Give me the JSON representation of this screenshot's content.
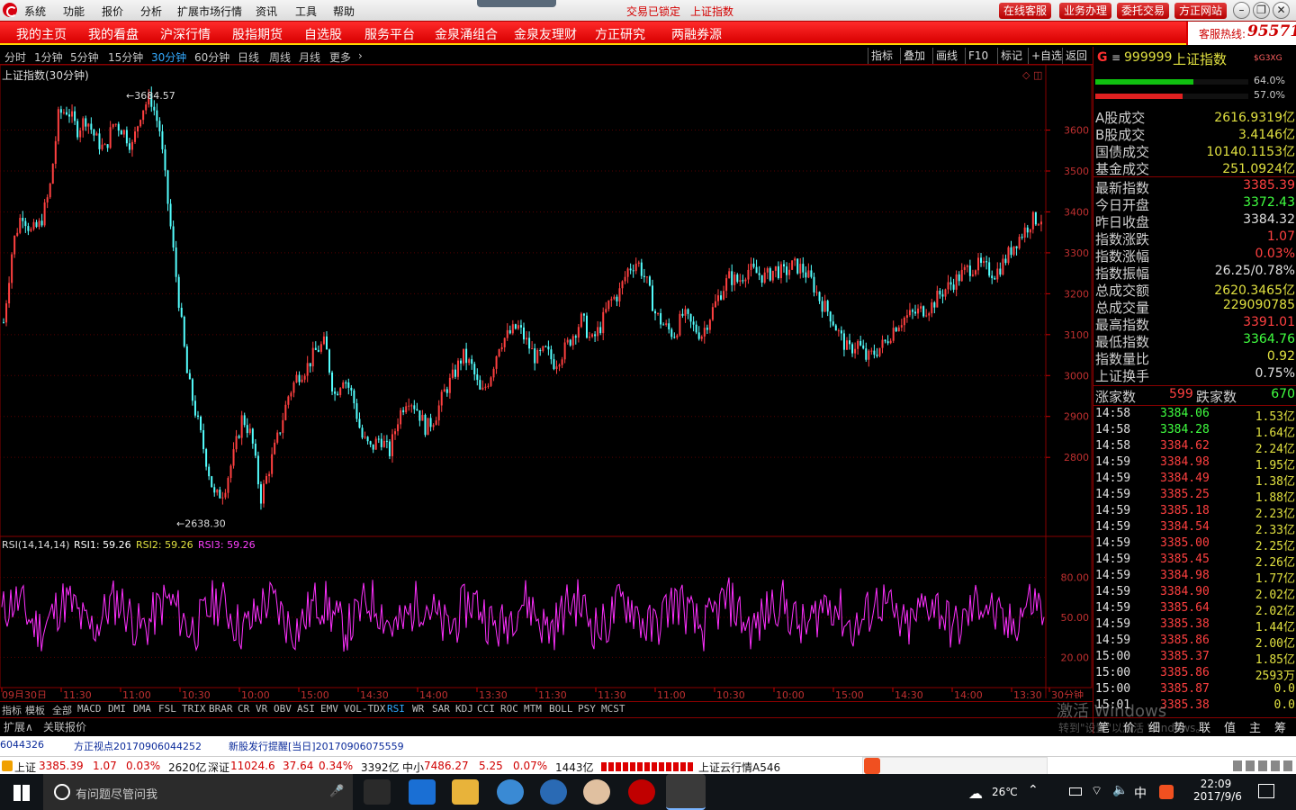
{
  "menubar": {
    "items": [
      "系统",
      "功能",
      "报价",
      "分析",
      "扩展市场行情",
      "资讯",
      "工具",
      "帮助"
    ],
    "status_lock": "交易已锁定",
    "status_index": "上证指数",
    "right_buttons": [
      "在线客服",
      "业务办理",
      "委托交易",
      "方正网站"
    ]
  },
  "navbar": {
    "items": [
      "我的主页",
      "我的看盘",
      "沪深行情",
      "股指期货",
      "自选股",
      "服务平台",
      "金泉涌组合",
      "金泉友理财",
      "方正研究",
      "两融券源"
    ],
    "hotline_label": "客服热线:",
    "hotline_number": "95571"
  },
  "periods": {
    "items": [
      "分时",
      "1分钟",
      "5分钟",
      "15分钟",
      "30分钟",
      "60分钟",
      "日线",
      "周线",
      "月线",
      "更多"
    ],
    "active": "30分钟",
    "tools": [
      "指标",
      "叠加",
      "画线",
      "F10",
      "标记",
      "+自选",
      "返回"
    ]
  },
  "chart_title": "上证指数(30分钟)",
  "chart_data": [
    {
      "type": "candlestick",
      "title": "上证指数(30分钟)",
      "y_ticks": [
        3600,
        3500,
        3400,
        3300,
        3200,
        3100,
        3000,
        2900,
        2800
      ],
      "ylim": [
        2620,
        3720
      ],
      "annotations": {
        "high": "3684.57",
        "low": "2638.30"
      },
      "x_tick_labels": [
        "09月30日",
        "11:30",
        "11:00",
        "10:30",
        "10:00",
        "15:00",
        "14:30",
        "14:00",
        "13:30",
        "11:30",
        "11:30",
        "11:00",
        "10:30",
        "10:00",
        "15:00",
        "14:30",
        "14:00",
        "13:30",
        "30分钟"
      ],
      "close_path": [
        3130,
        3320,
        3400,
        3350,
        3370,
        3450,
        3640,
        3650,
        3600,
        3630,
        3580,
        3550,
        3620,
        3600,
        3560,
        3650,
        3680,
        3600,
        3400,
        3200,
        3000,
        2900,
        2800,
        2700,
        2720,
        2800,
        2900,
        2850,
        2700,
        2780,
        2860,
        2950,
        3000,
        3020,
        3060,
        3080,
        2950,
        3000,
        2950,
        2850,
        2820,
        2850,
        2810,
        2900,
        2950,
        2920,
        2870,
        2900,
        2960,
        3000,
        3050,
        3020,
        2950,
        3000,
        3080,
        3100,
        3120,
        3080,
        3040,
        3060,
        3030,
        3060,
        3100,
        3140,
        3080,
        3120,
        3180,
        3200,
        3260,
        3280,
        3230,
        3150,
        3120,
        3100,
        3150,
        3120,
        3100,
        3150,
        3200,
        3240,
        3230,
        3260,
        3250,
        3240,
        3260,
        3250,
        3270,
        3260,
        3230,
        3180,
        3150,
        3100,
        3060,
        3080,
        3040,
        3060,
        3080,
        3120,
        3140,
        3150,
        3160,
        3170,
        3200,
        3220,
        3240,
        3260,
        3270,
        3260,
        3250,
        3280,
        3320,
        3350,
        3380,
        3385
      ]
    },
    {
      "type": "line",
      "title": "RSI(14,14,14)",
      "series": [
        {
          "name": "RSI1",
          "last": "59.26"
        },
        {
          "name": "RSI2",
          "last": "59.26"
        },
        {
          "name": "RSI3",
          "last": "59.26"
        }
      ],
      "y_ticks": [
        80,
        50,
        20
      ],
      "ylim": [
        0,
        100
      ]
    }
  ],
  "rsi_label": {
    "name": "RSI(14,14,14)",
    "rsi1": "RSI1: 59.26",
    "rsi2": "RSI2: 59.26",
    "rsi3": "RSI3: 59.26"
  },
  "indicators": {
    "items": [
      "指标",
      "模板",
      "全部",
      "MACD",
      "DMI",
      "DMA",
      "FSL",
      "TRIX",
      "BRAR",
      "CR",
      "VR",
      "OBV",
      "ASI",
      "EMV",
      "VOL-TDX",
      "RSI",
      "WR",
      "SAR",
      "KDJ",
      "CCI",
      "ROC",
      "MTM",
      "BOLL",
      "PSY",
      "MCST"
    ],
    "active": "RSI",
    "ext": [
      "扩展∧",
      "关联报价"
    ]
  },
  "stock": {
    "code": "999999",
    "name": "上证指数",
    "tag": "$G3XG",
    "bar1_pct": "64.0%",
    "bar2_pct": "57.0%",
    "bar1": 0.64,
    "bar2": 0.57,
    "turnover": [
      {
        "label": "A股成交",
        "value": "2616.9319亿"
      },
      {
        "label": "B股成交",
        "value": "3.4146亿"
      },
      {
        "label": "国债成交",
        "value": "10140.1153亿"
      },
      {
        "label": "基金成交",
        "value": "251.0924亿"
      }
    ],
    "stats": [
      {
        "label": "最新指数",
        "value": "3385.39",
        "color": "#ff4040"
      },
      {
        "label": "今日开盘",
        "value": "3372.43",
        "color": "#40ff40"
      },
      {
        "label": "昨日收盘",
        "value": "3384.32",
        "color": "#e0e0e0"
      },
      {
        "label": "指数涨跌",
        "value": "1.07",
        "color": "#ff4040"
      },
      {
        "label": "指数涨幅",
        "value": "0.03%",
        "color": "#ff4040"
      },
      {
        "label": "指数振幅",
        "value": "26.25/0.78%",
        "color": "#e0e0e0"
      },
      {
        "label": "总成交额",
        "value": "2620.3465亿",
        "color": "#e0e040"
      },
      {
        "label": "总成交量",
        "value": "229090785",
        "color": "#e0e040"
      },
      {
        "label": "最高指数",
        "value": "3391.01",
        "color": "#ff4040"
      },
      {
        "label": "最低指数",
        "value": "3364.76",
        "color": "#40ff40"
      },
      {
        "label": "指数量比",
        "value": "0.92",
        "color": "#e0e040"
      },
      {
        "label": "上证换手",
        "value": "0.75%",
        "color": "#e0e0e0"
      }
    ],
    "up_label": "涨家数",
    "up_count": "599",
    "down_label": "跌家数",
    "down_count": "670",
    "ticks": [
      {
        "t": "14:58",
        "p": "3384.06",
        "c": "#40ff40",
        "v": "1.53亿"
      },
      {
        "t": "14:58",
        "p": "3384.28",
        "c": "#40ff40",
        "v": "1.64亿"
      },
      {
        "t": "14:58",
        "p": "3384.62",
        "c": "#ff4040",
        "v": "2.24亿"
      },
      {
        "t": "14:59",
        "p": "3384.98",
        "c": "#ff4040",
        "v": "1.95亿"
      },
      {
        "t": "14:59",
        "p": "3384.49",
        "c": "#ff4040",
        "v": "1.38亿"
      },
      {
        "t": "14:59",
        "p": "3385.25",
        "c": "#ff4040",
        "v": "1.88亿"
      },
      {
        "t": "14:59",
        "p": "3385.18",
        "c": "#ff4040",
        "v": "2.23亿"
      },
      {
        "t": "14:59",
        "p": "3384.54",
        "c": "#ff4040",
        "v": "2.33亿"
      },
      {
        "t": "14:59",
        "p": "3385.00",
        "c": "#ff4040",
        "v": "2.25亿"
      },
      {
        "t": "14:59",
        "p": "3385.45",
        "c": "#ff4040",
        "v": "2.26亿"
      },
      {
        "t": "14:59",
        "p": "3384.98",
        "c": "#ff4040",
        "v": "1.77亿"
      },
      {
        "t": "14:59",
        "p": "3384.90",
        "c": "#ff4040",
        "v": "2.02亿"
      },
      {
        "t": "14:59",
        "p": "3385.64",
        "c": "#ff4040",
        "v": "2.02亿"
      },
      {
        "t": "14:59",
        "p": "3385.38",
        "c": "#ff4040",
        "v": "1.44亿"
      },
      {
        "t": "14:59",
        "p": "3385.86",
        "c": "#ff4040",
        "v": "2.00亿"
      },
      {
        "t": "15:00",
        "p": "3385.37",
        "c": "#ff4040",
        "v": "1.85亿"
      },
      {
        "t": "15:00",
        "p": "3385.86",
        "c": "#ff4040",
        "v": "2593万"
      },
      {
        "t": "15:00",
        "p": "3385.87",
        "c": "#ff4040",
        "v": "0.0"
      },
      {
        "t": "15:01",
        "p": "3385.38",
        "c": "#ff4040",
        "v": "0.0"
      }
    ],
    "bottom_tabs": [
      "笔",
      "价",
      "细",
      "势",
      "联",
      "值",
      "主",
      "筹"
    ]
  },
  "watermark": {
    "line1": "激活 Windows",
    "line2": "转到\"设置\"以激活 Windows。"
  },
  "news": [
    "6044326",
    "方正视点20170906044252",
    "新股发行提醒[当日]20170906075559"
  ],
  "quotes": {
    "sh_label": "上证",
    "sh_value": "3385.39",
    "sh_change": "1.07",
    "sh_pct": "0.03%",
    "sh_amount": "2620亿",
    "sz_label": "深证",
    "sz_value": "11024.6",
    "sz_change": "37.64",
    "sz_pct": "0.34%",
    "sz_amount": "3392亿",
    "zx_label": "中小",
    "zx_value": "7486.27",
    "zx_change": "5.25",
    "zx_pct": "0.07%",
    "zx_amount": "1443亿",
    "cloud": "上证云行情A546"
  },
  "taskbar": {
    "search_placeholder": "有问题尽管问我",
    "temperature": "26℃",
    "ime": "中",
    "time": "22:09",
    "date": "2017/9/6"
  }
}
